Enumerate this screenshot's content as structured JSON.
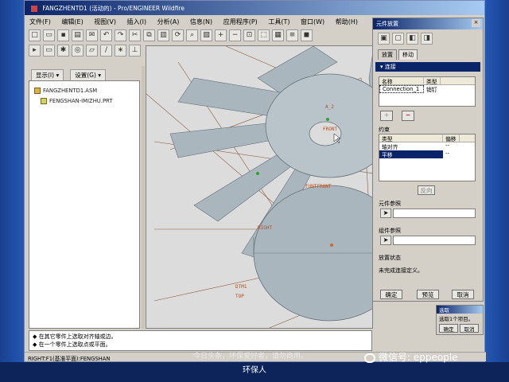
{
  "window": {
    "title": "FANGZHENTD1 (活动的) - Pro/ENGINEER Wildfire"
  },
  "menu": [
    "文件(F)",
    "编辑(E)",
    "视图(V)",
    "插入(I)",
    "分析(A)",
    "信息(N)",
    "应用程序(P)",
    "工具(T)",
    "窗口(W)",
    "帮助(H)"
  ],
  "tree": {
    "show_label": "显示(I) ▾",
    "settings_label": "设置(G) ▾",
    "items": [
      "FANGZHENTD1.ASM",
      "FENGSHAN-IMIZHU.PRT"
    ]
  },
  "viewport": {
    "labels": [
      "FRONT",
      "FUNTFRONT",
      "DTM1",
      "TOP",
      "RIGHT",
      "A_2"
    ],
    "colors": {
      "background": "#dcdcdc",
      "part": "#a9b6bd",
      "datum": "#c86a2a"
    }
  },
  "status_messages": [
    "在其它零件上选取对齐轴或边。",
    "在一个零件上选取点或平面。"
  ],
  "status_line": "RIGHT:F1(基准平面):FENGSHAN",
  "dashboard": {
    "title": "元件放置",
    "tabs": [
      "放置",
      "移动"
    ],
    "section": "连接",
    "connections": {
      "headers": [
        "名称",
        "类型"
      ],
      "rows": [
        [
          "Connection_1",
          "销钉"
        ]
      ]
    },
    "constraints_label": "约束",
    "constraints": {
      "headers": [
        "类型",
        "偏移"
      ],
      "rows": [
        [
          "轴对齐",
          "--"
        ],
        [
          "平移",
          "--"
        ]
      ]
    },
    "reverse_button": "反向",
    "component_ref_label": "元件参照",
    "assembly_ref_label": "组件参照",
    "placement_status_label": "放置状态",
    "placement_status": "未完成连接定义。",
    "ok": "确定",
    "preview": "预览",
    "cancel": "取消"
  },
  "select_popup": {
    "title": "选取",
    "text": "选取1个项目。",
    "ok": "确定",
    "cancel": "取消"
  },
  "overlay": {
    "caption_line1": "今日头条，环保爱好者，请勿商用。",
    "caption_line2": "环保人",
    "wechat": "微信号: eppeople"
  }
}
